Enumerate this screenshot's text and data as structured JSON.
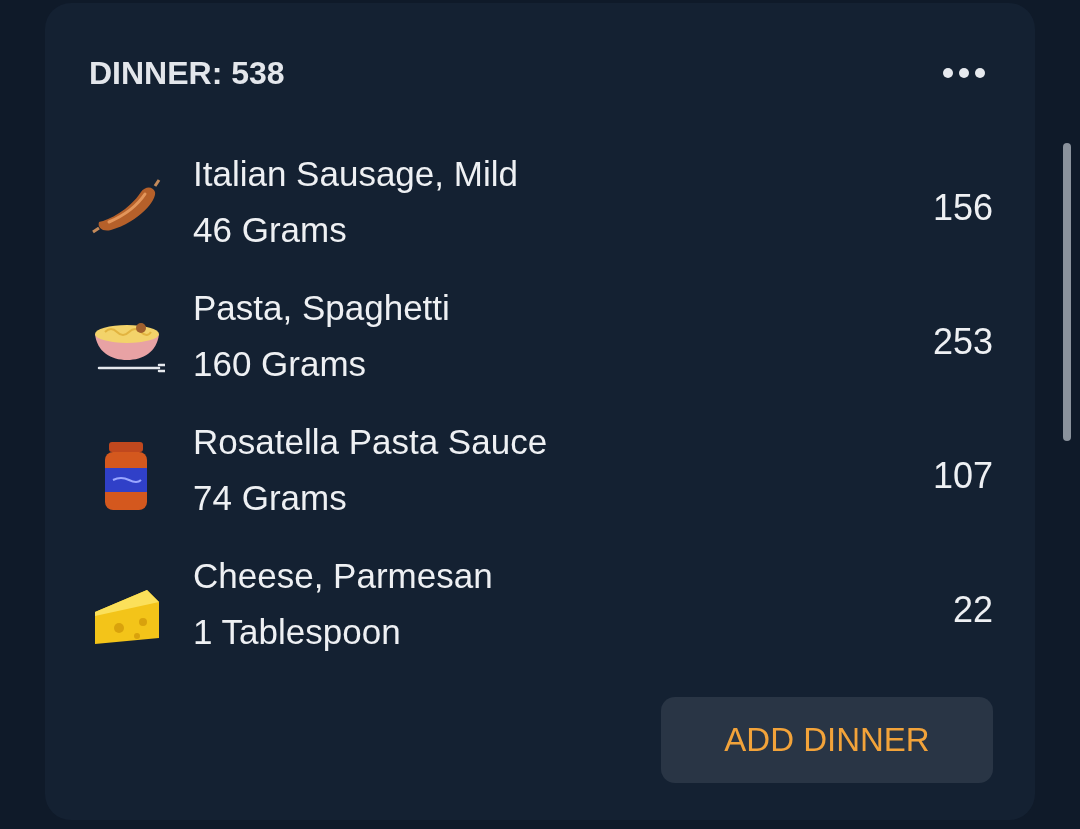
{
  "meal_card": {
    "title": "DINNER: 538",
    "items": [
      {
        "kind": "sausage",
        "name": "Italian Sausage, Mild",
        "amount": "46 Grams",
        "calories": "156"
      },
      {
        "kind": "spaghetti",
        "name": "Pasta, Spaghetti",
        "amount": "160 Grams",
        "calories": "253"
      },
      {
        "kind": "sauce",
        "name": "Rosatella Pasta Sauce",
        "amount": "74 Grams",
        "calories": "107"
      },
      {
        "kind": "cheese",
        "name": "Cheese, Parmesan",
        "amount": "1 Tablespoon",
        "calories": "22"
      }
    ],
    "add_button": "ADD DINNER"
  }
}
